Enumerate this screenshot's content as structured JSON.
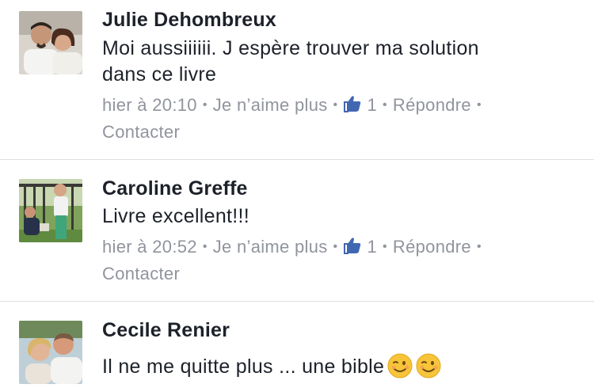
{
  "comments": [
    {
      "author": "Julie Dehombreux",
      "text_line1": "Moi aussiiiiii.  J espère trouver ma solution",
      "text_line2": "dans ce livre",
      "time": "hier à 20:10",
      "unlike": "Je n’aime plus",
      "likes": "1",
      "reply": "Répondre",
      "contact": "Contacter",
      "avatar_icon": "user-photo-couple"
    },
    {
      "author": "Caroline Greffe",
      "text_line1": "Livre excellent!!!",
      "time": "hier à 20:52",
      "unlike": "Je n’aime plus",
      "likes": "1",
      "reply": "Répondre",
      "contact": "Contacter",
      "avatar_icon": "user-photo-garden"
    },
    {
      "author": "Cecile Renier",
      "text_line1": "Il ne me quitte plus ... une bible",
      "emojis": [
        "winking-face-emoji",
        "winking-face-emoji"
      ],
      "avatar_icon": "user-photo-couple-smiling"
    }
  ],
  "separator": "•",
  "colors": {
    "author": "#1d2129",
    "meta": "#90949c",
    "like_blue": "#4267b2",
    "divider": "#dcdee3"
  }
}
